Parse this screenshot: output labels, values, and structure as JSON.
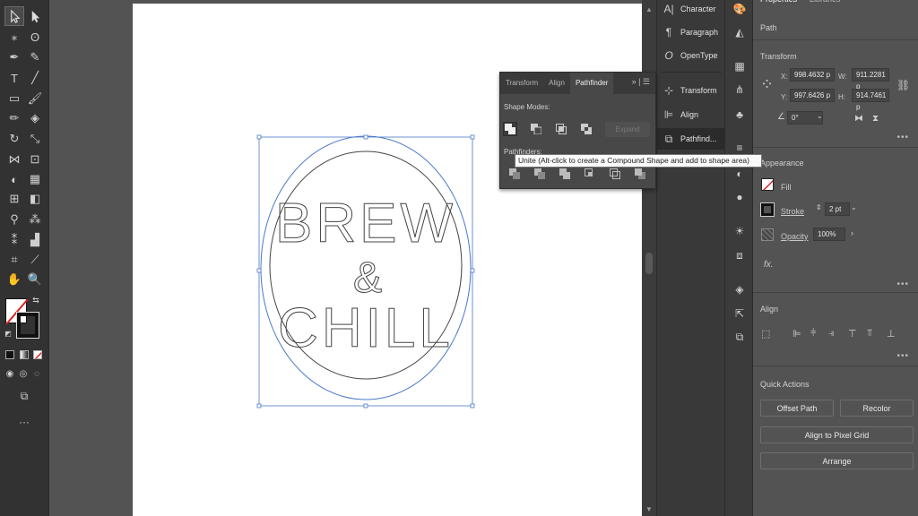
{
  "dock": {
    "items": [
      {
        "icon": "character-icon",
        "label": "Character"
      },
      {
        "icon": "paragraph-icon",
        "label": "Paragraph"
      },
      {
        "icon": "opentype-icon",
        "label": "OpenType"
      },
      {
        "icon": "transform-icon",
        "label": "Transform"
      },
      {
        "icon": "align-icon",
        "label": "Align"
      },
      {
        "icon": "pathfinder-icon",
        "label": "Pathfind..."
      }
    ]
  },
  "pathfinder": {
    "tabs": [
      "Transform",
      "Align",
      "Pathfinder"
    ],
    "active_tab": "Pathfinder",
    "shape_modes_label": "Shape Modes:",
    "pathfinders_label": "Pathfinders:",
    "expand_label": "Expand",
    "tooltip": "Unite (Alt-click to create a Compound Shape and add to shape area)"
  },
  "artwork": {
    "line1": "BREW",
    "line2": "&",
    "line3": "CHILL"
  },
  "properties": {
    "tabs": [
      "Properties",
      "Libraries"
    ],
    "selection_type": "Path",
    "transform": {
      "title": "Transform",
      "x_label": "X:",
      "x": "998.4632 p",
      "y_label": "Y:",
      "y": "997.6426 p",
      "w_label": "W:",
      "w": "911.2281 p",
      "h_label": "H:",
      "h": "914.7461 p",
      "angle": "0°"
    },
    "appearance": {
      "title": "Appearance",
      "fill_label": "Fill",
      "stroke_label": "Stroke",
      "stroke_value": "2 pt",
      "opacity_label": "Opacity",
      "opacity_value": "100%",
      "fx_label": "fx."
    },
    "align": {
      "title": "Align"
    },
    "quick_actions": {
      "title": "Quick Actions",
      "offset_path": "Offset Path",
      "recolor": "Recolor",
      "align_pixel": "Align to Pixel Grid",
      "arrange": "Arrange"
    }
  },
  "colors": {
    "selection_blue": "#4a78c8",
    "ui_dark": "#323232",
    "panel": "#535353"
  }
}
